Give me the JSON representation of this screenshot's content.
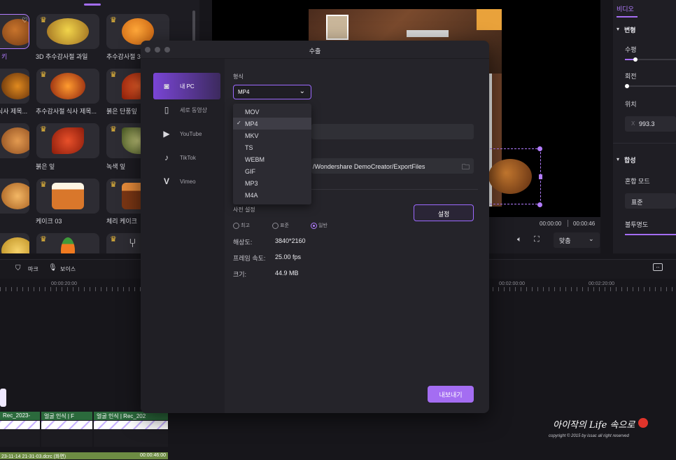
{
  "assets": {
    "labels": [
      "3D 추수감사절 과일",
      "추수감사절 3",
      "추수감사절 식사 제목...",
      "붉은 단풍잎",
      "붉은 잎",
      "녹색 잎",
      "케이크 03",
      "체리 케이크"
    ],
    "label_partial_left": [
      "키",
      "식사 제목..."
    ]
  },
  "right_panel": {
    "tab": "비디오",
    "section_transform": "변형",
    "horizontal": "수평",
    "rotate": "회전",
    "position": "위치",
    "x_prefix": "X",
    "x_value": "993.3",
    "section_composite": "합성",
    "blend_mode": "혼합 모드",
    "blend_value": "표준",
    "opacity": "불투명도"
  },
  "preview": {
    "time_current": "00:00:00",
    "time_total": "00:00:46",
    "fit_label": "맞춤"
  },
  "timeline": {
    "tools": [
      "마크",
      "보이스"
    ],
    "ticks": [
      "00:00:20:00",
      "00:02:00:00",
      "00:02:20:00"
    ],
    "clips": [
      {
        "head": "Rec_2023-"
      },
      {
        "head": "얼굴 인식 | F"
      },
      {
        "head": "얼굴 인식 | Rec_202"
      }
    ],
    "bottom_track": "23-11-14 21-31-03.dcrc (화면)",
    "bottom_track_time": "00:00:46:00"
  },
  "watermark": {
    "line1": "아이작의 Life 속으로",
    "line2": "copyright © 2015 by issac all right reserved"
  },
  "modal": {
    "title": "수출",
    "sidebar": [
      {
        "label": "내 PC",
        "icon": "pc-icon"
      },
      {
        "label": "세로 동영상",
        "icon": "phone-icon"
      },
      {
        "label": "YouTube",
        "icon": "youtube-icon"
      },
      {
        "label": "TikTok",
        "icon": "tiktok-icon"
      },
      {
        "label": "Vimeo",
        "icon": "vimeo-icon"
      }
    ],
    "format_label": "형식",
    "format_value": "MP4",
    "format_options": [
      "MOV",
      "MP4",
      "MKV",
      "TS",
      "WEBM",
      "GIF",
      "MP3",
      "M4A"
    ],
    "path_value": "/Wondershare DemoCreator/ExportFiles",
    "preset_label": "사전 설정",
    "settings_button": "설정",
    "presets": [
      "최고",
      "표준",
      "일반"
    ],
    "resolution_label": "해상도:",
    "resolution_value": "3840*2160",
    "framerate_label": "프레임 속도:",
    "framerate_value": "25.00 fps",
    "size_label": "크기:",
    "size_value": "44.9 MB",
    "export_button": "내보내기"
  },
  "colors": {
    "accent": "#a46df2",
    "accent_border": "#9d6aff",
    "background": "#17161b",
    "modal_bg": "#25242a"
  }
}
